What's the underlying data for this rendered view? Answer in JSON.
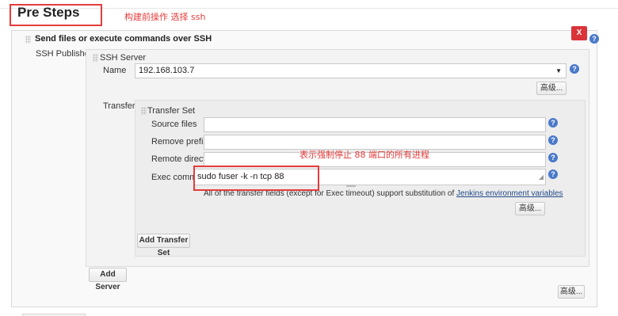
{
  "header": {
    "title": "Pre Steps",
    "annotation_top": "构建前操作  选择 ssh"
  },
  "step": {
    "title": "Send files or execute commands over SSH",
    "delete_label": "X",
    "publishers_label": "SSH Publishers",
    "ssh_server_label": "SSH Server",
    "name_label": "Name",
    "name_value": "192.168.103.7",
    "advanced_label": "高级...",
    "transfers_label": "Transfers",
    "transfer_set_label": "Transfer Set",
    "source_files_label": "Source files",
    "source_files_value": "",
    "remove_prefix_label": "Remove prefix",
    "remove_prefix_value": "",
    "remote_directory_label": "Remote directory",
    "remote_directory_value": "",
    "exec_command_label": "Exec command",
    "exec_command_value": "sudo fuser -k -n tcp 88",
    "annotation_middle": "表示强制停止 88 端口的所有进程",
    "note_text": "All of the transfer fields (except for Exec timeout) support substitution of ",
    "note_link": "Jenkins environment variables",
    "add_transfer_set_label": "Add Transfer Set",
    "add_server_label": "Add Server"
  },
  "help_glyph": "?",
  "colors": {
    "annotation": "#e43c3c",
    "delete_button": "#d9343a",
    "help_icon": "#4a79c9",
    "link": "#204a87"
  }
}
